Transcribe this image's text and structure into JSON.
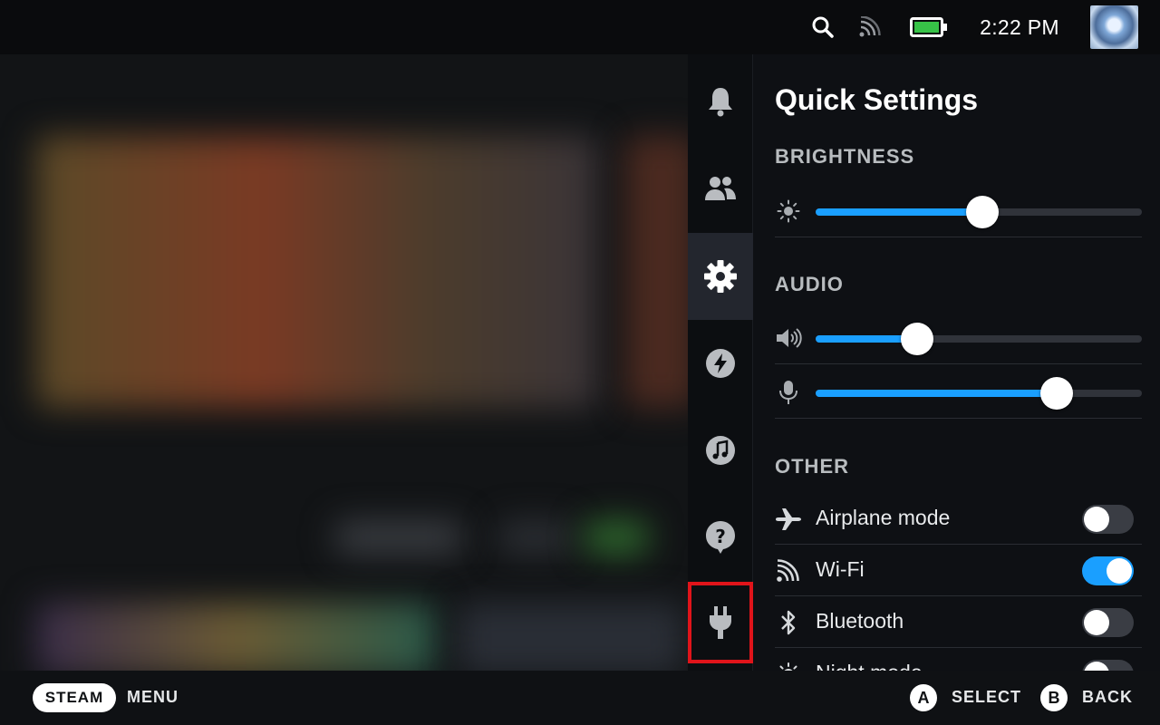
{
  "status_bar": {
    "time": "2:22 PM",
    "icons": [
      "search-icon",
      "wifi-signal-icon",
      "battery-icon"
    ],
    "battery_color": "#37c247"
  },
  "side_tabs": [
    {
      "name": "notifications",
      "icon": "bell-icon"
    },
    {
      "name": "friends",
      "icon": "friends-icon"
    },
    {
      "name": "settings",
      "icon": "gear-icon",
      "active": true
    },
    {
      "name": "performance",
      "icon": "lightning-icon"
    },
    {
      "name": "music",
      "icon": "music-note-icon"
    },
    {
      "name": "help",
      "icon": "question-icon"
    },
    {
      "name": "power",
      "icon": "plug-icon",
      "highlighted": true
    }
  ],
  "quick_settings": {
    "title": "Quick Settings",
    "brightness": {
      "label": "BRIGHTNESS",
      "value_percent": 51
    },
    "audio": {
      "label": "AUDIO",
      "volume_percent": 31,
      "mic_percent": 74
    },
    "other": {
      "label": "OTHER",
      "toggles": [
        {
          "label": "Airplane mode",
          "on": false,
          "icon": "airplane-icon"
        },
        {
          "label": "Wi-Fi",
          "on": true,
          "icon": "wifi-icon"
        },
        {
          "label": "Bluetooth",
          "on": false,
          "icon": "bluetooth-icon"
        },
        {
          "label": "Night mode",
          "on": false,
          "icon": "night-mode-icon"
        }
      ]
    }
  },
  "bottom_bar": {
    "steam_label": "STEAM",
    "menu_label": "MENU",
    "a_glyph": "A",
    "select_label": "SELECT",
    "b_glyph": "B",
    "back_label": "BACK"
  },
  "colors": {
    "accent": "#1a9fff",
    "highlight_box": "#e0141a"
  }
}
